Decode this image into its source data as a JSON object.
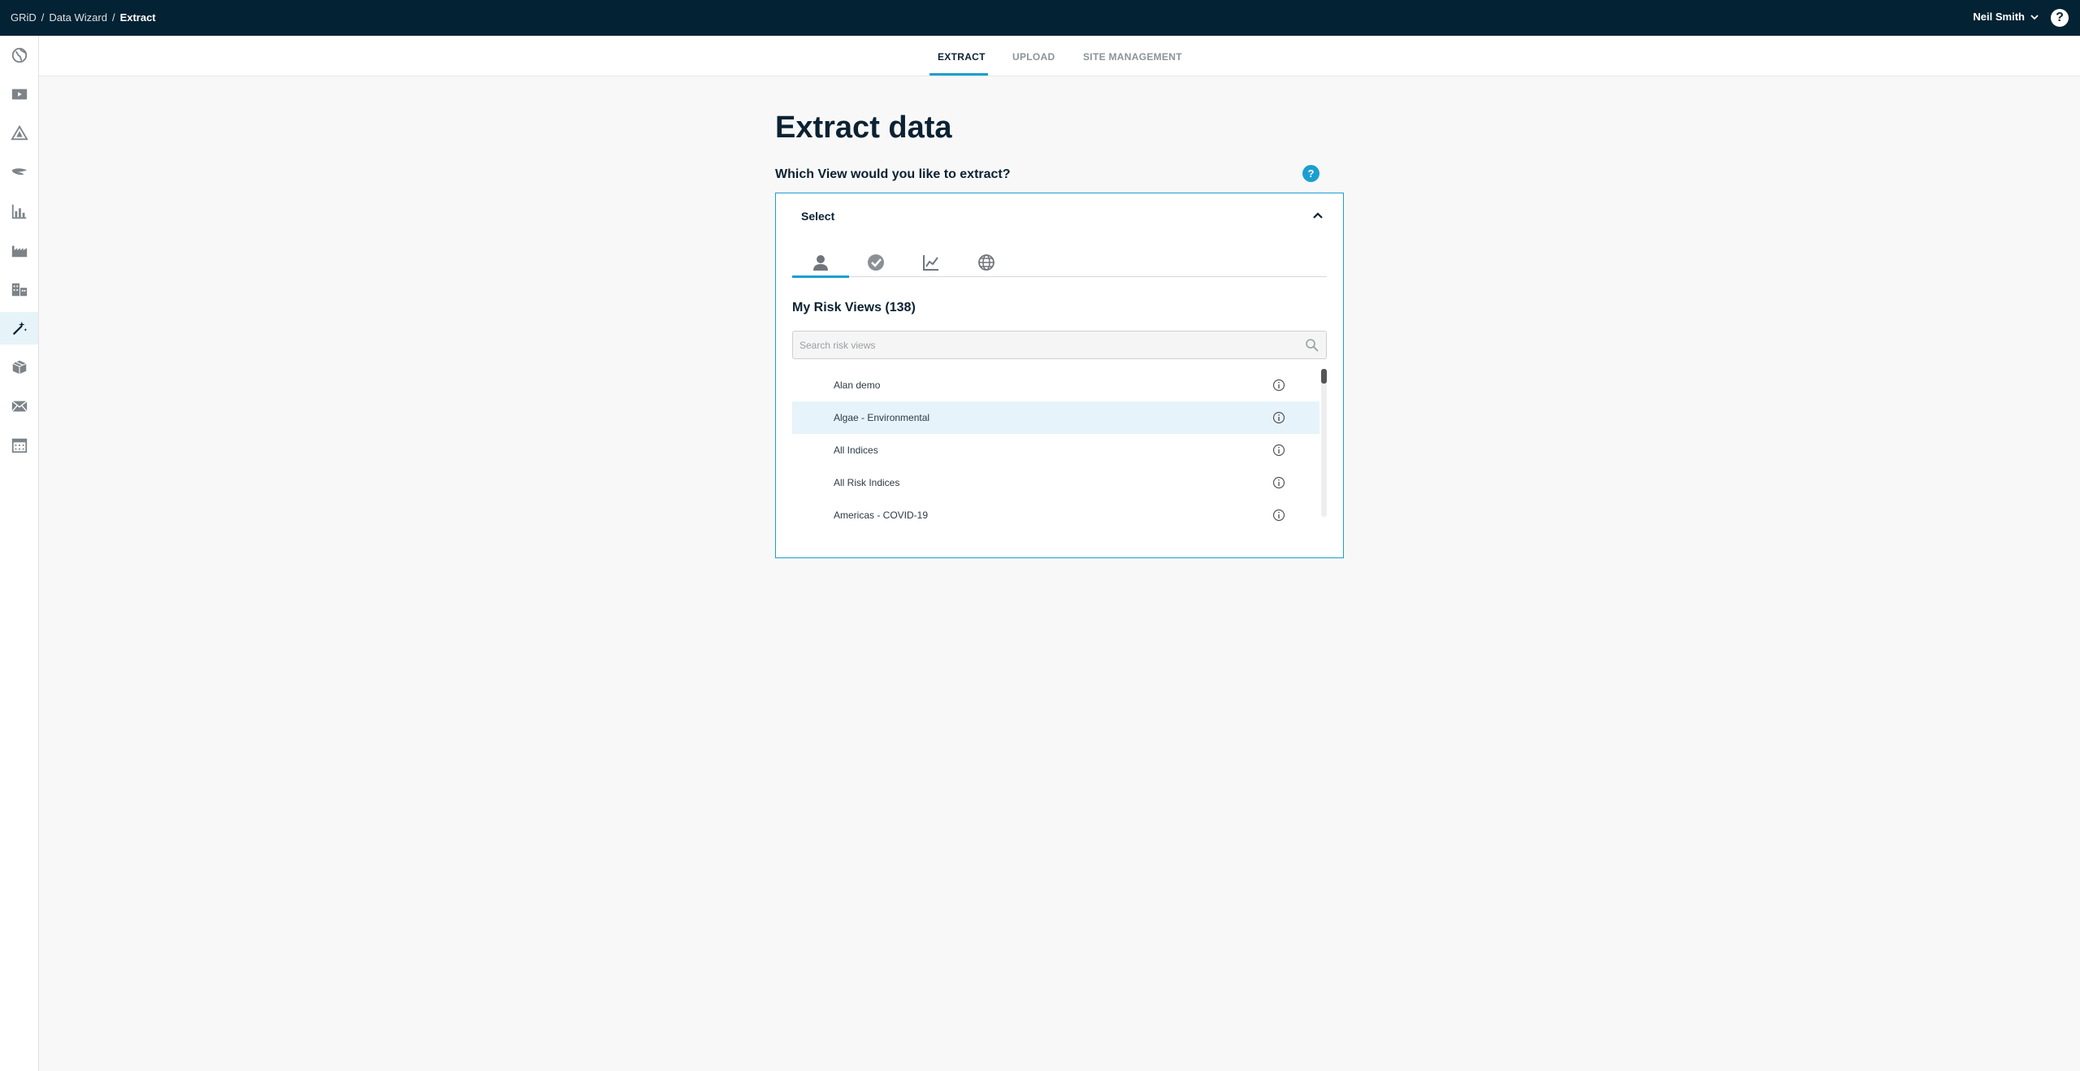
{
  "breadcrumb": {
    "items": [
      "GRiD",
      "Data Wizard"
    ],
    "separator": "/",
    "current": "Extract"
  },
  "user": {
    "name": "Neil Smith"
  },
  "help_symbol": "?",
  "sidebar": {
    "items": [
      {
        "icon": "globe-icon"
      },
      {
        "icon": "play-icon"
      },
      {
        "icon": "warning-triangle-icon"
      },
      {
        "icon": "wings-icon"
      },
      {
        "icon": "bar-chart-icon"
      },
      {
        "icon": "factory-icon"
      },
      {
        "icon": "buildings-icon"
      },
      {
        "icon": "magic-wand-icon",
        "active": true
      },
      {
        "icon": "boxes-icon"
      },
      {
        "icon": "envelope-icon"
      },
      {
        "icon": "calendar-icon"
      }
    ]
  },
  "tabs": [
    {
      "label": "EXTRACT",
      "active": true
    },
    {
      "label": "UPLOAD",
      "active": false
    },
    {
      "label": "SITE MANAGEMENT",
      "active": false
    }
  ],
  "main": {
    "title": "Extract data",
    "question": "Which View would you like to extract?",
    "select_label": "Select"
  },
  "dropdown": {
    "view_tabs": [
      {
        "icon": "person-icon",
        "active": true
      },
      {
        "icon": "shared-globe-icon",
        "active": false
      },
      {
        "icon": "line-chart-icon",
        "active": false
      },
      {
        "icon": "globe-icon",
        "active": false
      }
    ],
    "heading": "My Risk Views (138)",
    "search_placeholder": "Search risk views",
    "items": [
      {
        "label": "Alan demo"
      },
      {
        "label": "Algae - Environmental",
        "highlighted": true
      },
      {
        "label": "All Indices"
      },
      {
        "label": "All Risk Indices"
      },
      {
        "label": "Americas - COVID-19"
      }
    ]
  },
  "colors": {
    "topbar": "#032233",
    "accent": "#1b9fd0",
    "highlight_row": "#e6f3fa",
    "text_dark": "#0b2233"
  }
}
